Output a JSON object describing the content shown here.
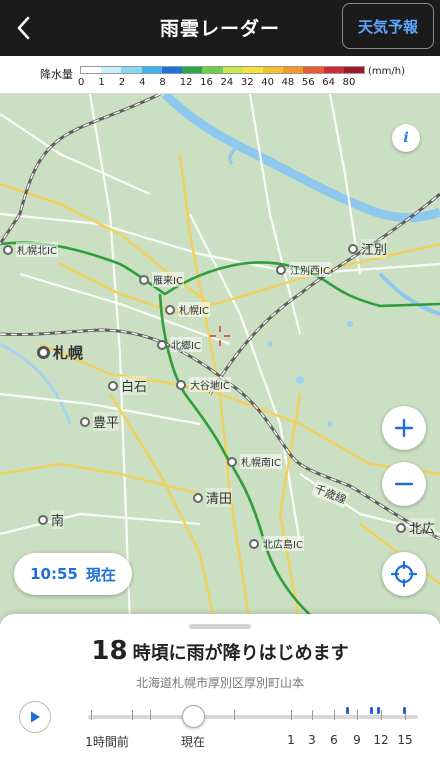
{
  "header": {
    "title": "雨雲レーダー",
    "forecast_button": "天気予報"
  },
  "legend": {
    "label": "降水量",
    "unit": "(mm/h)",
    "ticks": [
      "0",
      "1",
      "2",
      "4",
      "8",
      "12",
      "16",
      "24",
      "32",
      "40",
      "48",
      "56",
      "64",
      "80"
    ],
    "colors": [
      "#ffffff",
      "#c8f0fa",
      "#87d8f5",
      "#3fb3ee",
      "#1f6fe0",
      "#2aa84a",
      "#6cd04a",
      "#c9e84a",
      "#f5e33a",
      "#f5c22e",
      "#f39a2a",
      "#ea5a32",
      "#d02a38",
      "#a01a2a"
    ]
  },
  "map": {
    "places": {
      "sapporo_kita_ic": "札幌北IC",
      "karikiri_ic": "雁来IC",
      "ebetsu_nishi_ic": "江別西IC",
      "ebetsu": "江別",
      "sapporo_ic": "札幌IC",
      "kitago_ic": "北郷IC",
      "sapporo": "札幌",
      "shiroishi": "白石",
      "oyachi_ic": "大谷地IC",
      "toyohira": "豊平",
      "sapporo_minami_ic": "札幌南IC",
      "kiyota": "清田",
      "chitose_line": "千歳線",
      "minami": "南",
      "kitahiroshima_ic": "北広島IC",
      "kitahiro": "北広"
    },
    "info_label": "i"
  },
  "controls": {
    "zoom_in": "+",
    "zoom_out": "−",
    "time": "10:55",
    "now": "現在"
  },
  "sheet": {
    "hour": "18",
    "message": "時頃に雨が降りはじめます",
    "location": "北海道札幌市厚別区厚別町山本",
    "timeline": {
      "labels": [
        "1時間前",
        "現在",
        "1",
        "3",
        "6",
        "9",
        "12",
        "15"
      ]
    }
  }
}
